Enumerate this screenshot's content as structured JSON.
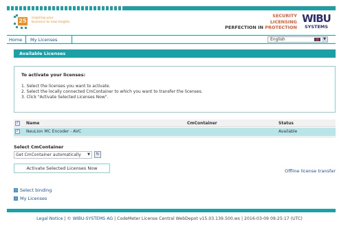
{
  "header": {
    "tagline_line1": "inspiring your",
    "tagline_line2": "business to new heights",
    "logo_number": "25",
    "security_line1": "SECURITY",
    "security_line2": "LICENSING",
    "security_line3a": "PERFECTION IN ",
    "security_line3b": "PROTECTION",
    "brand_top": "WIBU",
    "brand_bottom": "SYSTEMS"
  },
  "nav": {
    "home": "Home",
    "my_licenses": "My Licenses",
    "language": "English"
  },
  "panel": {
    "title": "Available Licenses"
  },
  "instructions": {
    "heading": "To activate your licenses:",
    "step1": "1. Select the licenses you want to activate.",
    "step2": "2. Select the locally connected CmContainer to which you want to transfer the licenses.",
    "step3": "3. Click \"Activate Selected Licenses Now\"."
  },
  "table": {
    "headers": {
      "name": "Name",
      "container": "CmContainer",
      "status": "Status"
    },
    "rows": [
      {
        "name": "NeuLion MC Encoder - AVC",
        "container": "",
        "status": "Available",
        "checked": true
      }
    ]
  },
  "container_select": {
    "label": "Select CmContainer",
    "value": "Get CmContainer automatically"
  },
  "actions": {
    "activate": "Activate Selected Licenses Now",
    "offline": "Offline license transfer"
  },
  "links": {
    "select_binding": "Select binding",
    "my_licenses": "My Licenses"
  },
  "footer": {
    "legal": "Legal Notice",
    "sep1": " | © ",
    "company": "WIBU-SYSTEMS AG",
    "rest": " | CodeMeter License Central WebDepot v15.03.139.500.ws | 2016-03-09 09:25:17 (UTC)"
  },
  "colors": {
    "accent": "#1aa0a6",
    "row_highlight": "#b9e5e8",
    "brand_orange": "#f28c1e",
    "brand_red": "#e8572a",
    "link": "#1a4f9a"
  }
}
